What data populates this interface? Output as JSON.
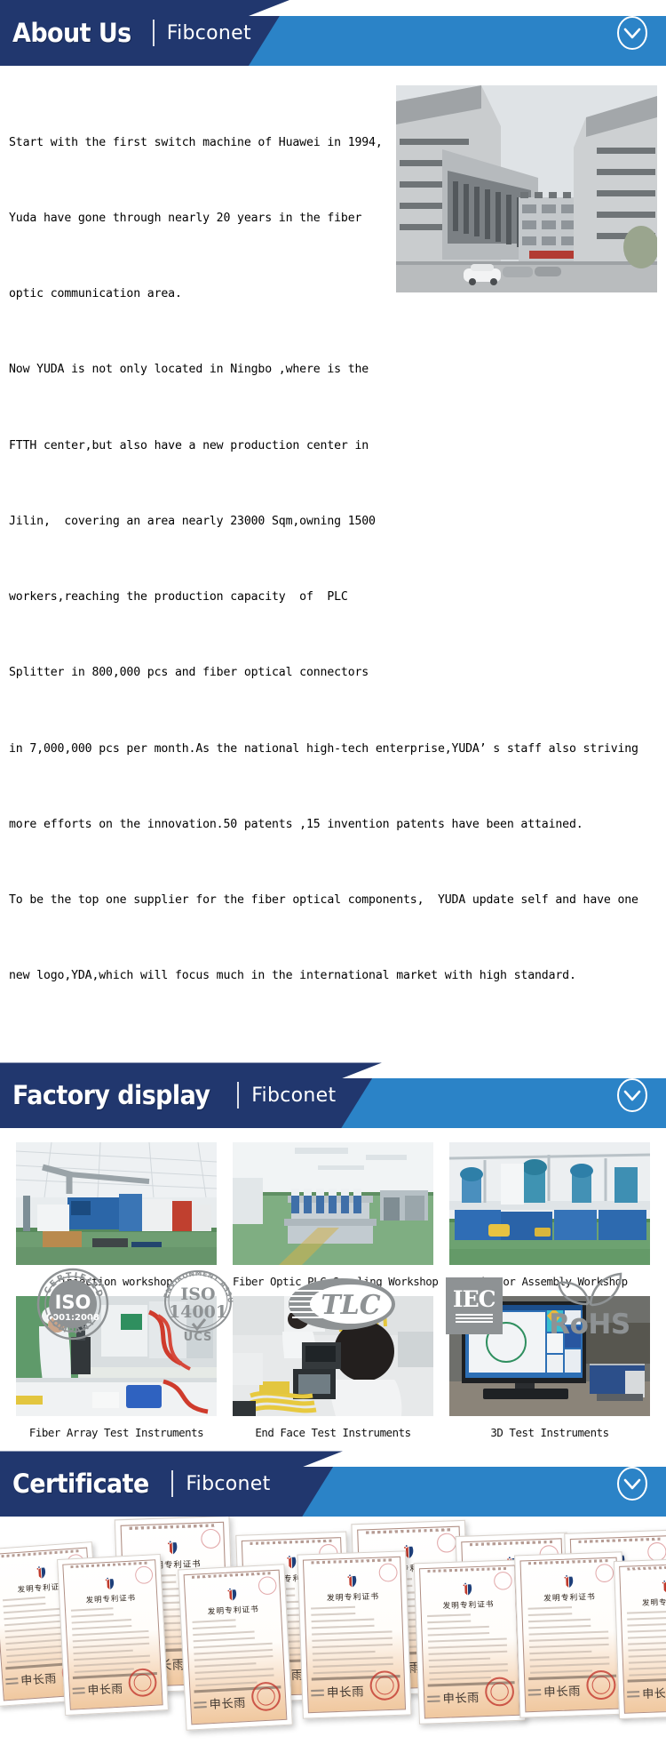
{
  "sections": [
    {
      "id": "about",
      "title": "About Us",
      "brand": "Fibconet",
      "toggle_icon": "chevron-down-circle-icon"
    },
    {
      "id": "factory",
      "title": "Factory display",
      "brand": "Fibconet",
      "toggle_icon": "chevron-down-circle-icon"
    },
    {
      "id": "certificate",
      "title": "Certificate",
      "brand": "Fibconet",
      "toggle_icon": "chevron-down-circle-icon"
    }
  ],
  "about": {
    "paragraph_lines": [
      "Start with the first switch machine of Huawei in 1994,",
      "Yuda have gone through nearly 20 years in the fiber",
      "optic communication area.",
      "Now YUDA is not only located in Ningbo ,where is the",
      "FTTH center,but also have a new production center in",
      "Jilin,  covering an area nearly 23000 Sqm,owning 1500",
      "workers,reaching the production capacity  of  PLC",
      "Splitter in 800,000 pcs and fiber optical connectors",
      "in 7,000,000 pcs per month.As the national high-tech enterprise,YUDA’ s staff also striving",
      "more efforts on the innovation.50 patents ,15 invention patents have been attained.",
      "To be the top one supplier for the fiber optical components,  YUDA update self and have one",
      "new logo,YDA,which will focus much in the international market with high standard."
    ],
    "photo_alt": "company-building-photo"
  },
  "factory": {
    "items": [
      {
        "caption": "injection workshop",
        "image": "injection-workshop-photo"
      },
      {
        "caption": "Fiber Optic PLC Coupling Workshop",
        "image": "plc-coupling-workshop-photo"
      },
      {
        "caption": "Adaptor Assembly Workshop",
        "image": "adaptor-assembly-workshop-photo"
      },
      {
        "caption": "Fiber Array Test Instruments",
        "image": "fiber-array-test-photo"
      },
      {
        "caption": "End Face Test Instruments",
        "image": "end-face-test-photo"
      },
      {
        "caption": "3D Test Instruments",
        "image": "3d-test-instruments-photo"
      }
    ]
  },
  "certificate": {
    "document_title": "发明专利证书",
    "signature": "申长雨",
    "count": 12
  },
  "badges": [
    {
      "name": "iso-9001-badge",
      "top": "CERTIFIED",
      "main": "ISO",
      "sub": "9001:2008",
      "bottom": "COMPANY"
    },
    {
      "name": "iso-14001-badge",
      "top": "ENVIRONMENT ASSURED FIRM",
      "main": "ISO",
      "sub": "14001",
      "bottom": "UCS"
    },
    {
      "name": "tlc-badge",
      "main": "TLC"
    },
    {
      "name": "iec-badge",
      "main": "IEC"
    },
    {
      "name": "rohs-badge",
      "main": "RoHS"
    }
  ],
  "colors": {
    "dark_navy": "#21376e",
    "light_blue": "#2b83c7",
    "badge_gray": "#8e9294",
    "text": "#000000"
  }
}
